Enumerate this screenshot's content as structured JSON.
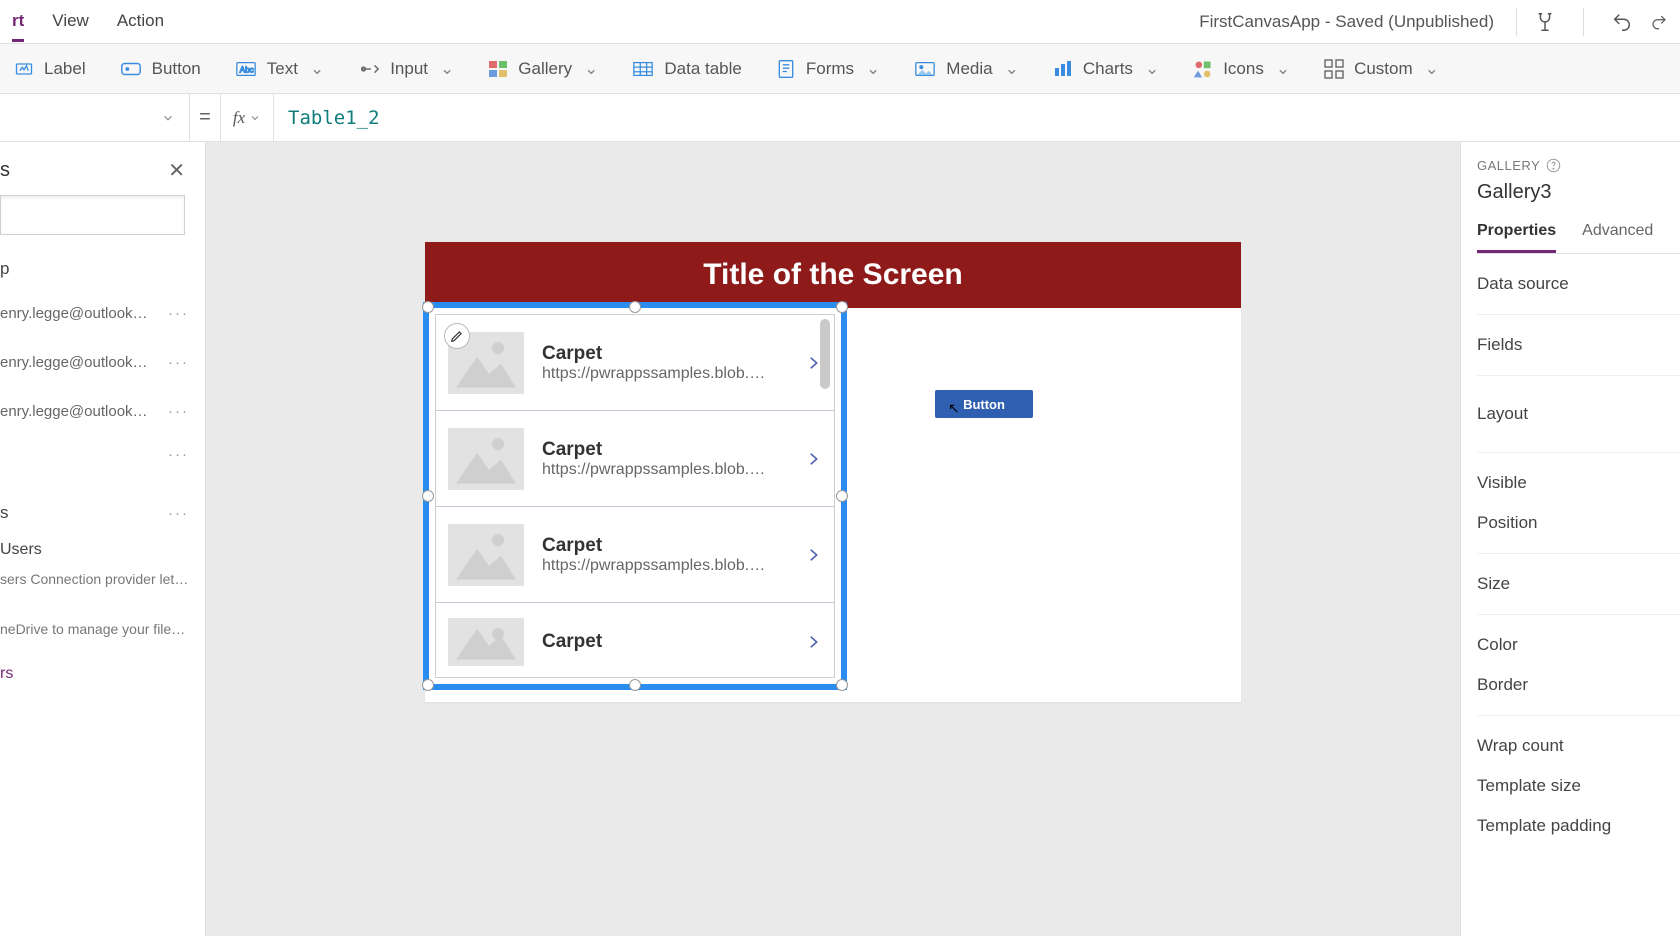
{
  "header": {
    "menus": [
      "rt",
      "View",
      "Action"
    ],
    "active_menu_index": 0,
    "app_status": "FirstCanvasApp - Saved (Unpublished)"
  },
  "ribbon": {
    "items": [
      {
        "label": "Label",
        "caret": false
      },
      {
        "label": "Button",
        "caret": false
      },
      {
        "label": "Text",
        "caret": true
      },
      {
        "label": "Input",
        "caret": true
      },
      {
        "label": "Gallery",
        "caret": true
      },
      {
        "label": "Data table",
        "caret": false
      },
      {
        "label": "Forms",
        "caret": true
      },
      {
        "label": "Media",
        "caret": true
      },
      {
        "label": "Charts",
        "caret": true
      },
      {
        "label": "Icons",
        "caret": true
      },
      {
        "label": "Custom",
        "caret": true
      }
    ]
  },
  "formula_bar": {
    "eq": "=",
    "fx": "fx",
    "value": "Table1_2"
  },
  "left_panel": {
    "title": "s",
    "group1_title": "p",
    "emails": [
      "enry.legge@outlook.com",
      "enry.legge@outlook.com",
      "enry.legge@outlook.com"
    ],
    "email4_placeholder": "",
    "group2_title": "s",
    "conn1_title": "Users",
    "conn1_sub": "sers Connection provider lets you ...",
    "conn2_sub": "neDrive to manage your files. Yo...",
    "source_link": "rs"
  },
  "canvas": {
    "screen_title": "Title of the Screen",
    "button_label": "Button",
    "gallery_items": [
      {
        "title": "Carpet",
        "sub": "https://pwrappssamples.blob.core."
      },
      {
        "title": "Carpet",
        "sub": "https://pwrappssamples.blob.core."
      },
      {
        "title": "Carpet",
        "sub": "https://pwrappssamples.blob.core."
      },
      {
        "title": "Carpet",
        "sub": ""
      }
    ]
  },
  "right_panel": {
    "type_label": "GALLERY",
    "control_name": "Gallery3",
    "tabs": [
      "Properties",
      "Advanced"
    ],
    "active_tab": 0,
    "props": [
      "Data source",
      "Fields",
      "Layout",
      "Visible",
      "Position",
      "Size",
      "Color",
      "Border",
      "Wrap count",
      "Template size",
      "Template padding"
    ]
  }
}
